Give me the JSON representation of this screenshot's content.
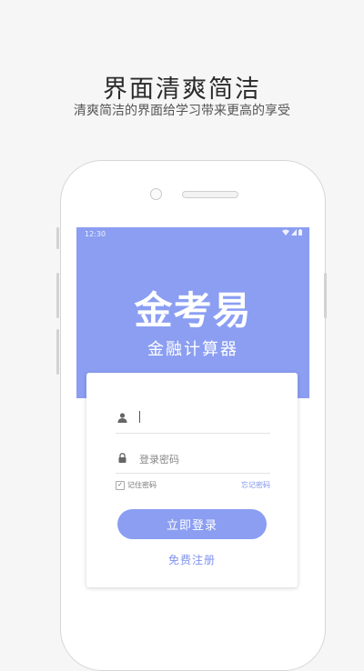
{
  "promo": {
    "title": "界面清爽简洁",
    "subtitle": "清爽简洁的界面给学习带来更高的享受"
  },
  "status_bar": {
    "time": "12:30",
    "icons": [
      "wifi-icon",
      "signal-icon",
      "battery-icon"
    ]
  },
  "hero": {
    "logo_text": "金考易",
    "app_name": "金融计算器",
    "background_color": "#8b9ef2"
  },
  "login_form": {
    "username": {
      "value": "",
      "icon": "user-icon"
    },
    "password": {
      "placeholder": "登录密码",
      "icon": "lock-icon"
    },
    "remember_label": "记住密码",
    "remember_checked": true,
    "forgot_label": "忘记密码",
    "login_label": "立即登录",
    "register_label": "免费注册",
    "accent_color": "#7f93ee"
  }
}
